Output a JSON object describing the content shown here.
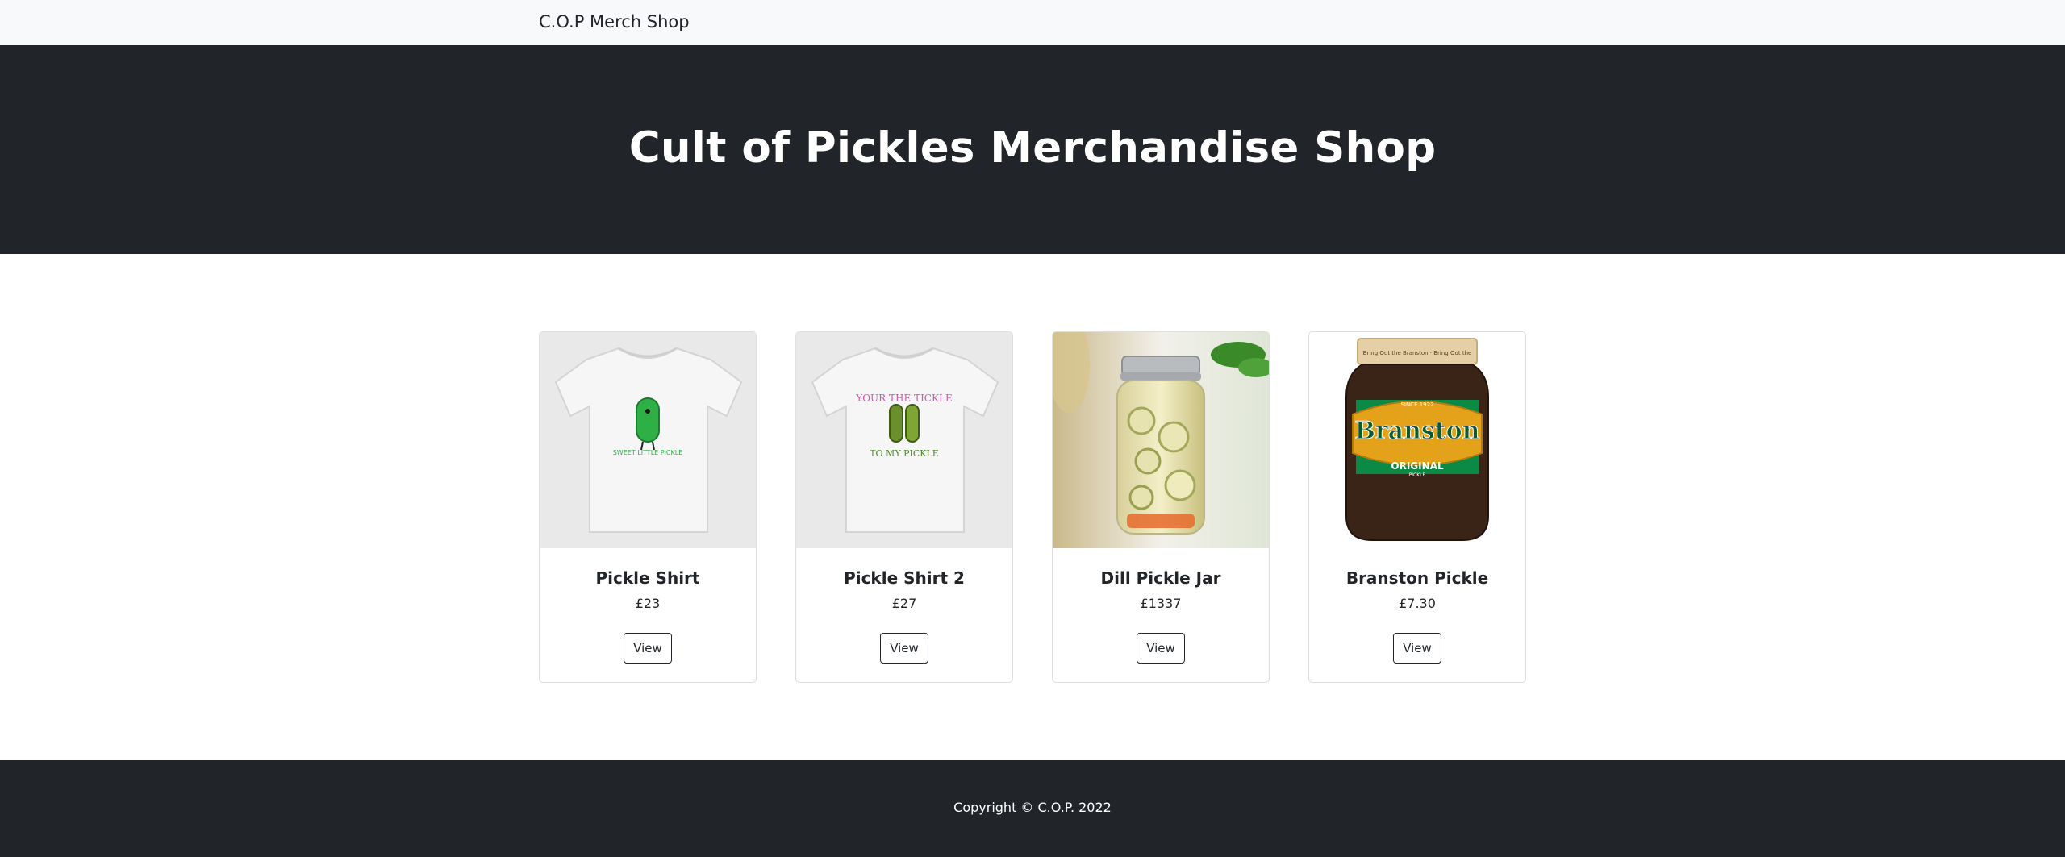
{
  "nav": {
    "brand": "C.O.P Merch Shop"
  },
  "hero": {
    "title": "Cult of Pickles Merchandise Shop"
  },
  "products": [
    {
      "name": "Pickle Shirt",
      "price": "£23",
      "button": "View",
      "image": "pickle-tshirt-image",
      "shirt_text": "SWEET LITTLE PICKLE"
    },
    {
      "name": "Pickle Shirt 2",
      "price": "£27",
      "button": "View",
      "image": "pickle-tshirt-2-image",
      "shirt_text_top": "YOUR THE TICKLE",
      "shirt_text_bottom": "TO MY PICKLE"
    },
    {
      "name": "Dill Pickle Jar",
      "price": "£1337",
      "button": "View",
      "image": "dill-pickle-jar-image"
    },
    {
      "name": "Branston Pickle",
      "price": "£7.30",
      "button": "View",
      "image": "branston-jar-image",
      "jar_brand": "Branston",
      "jar_since": "SINCE 1922",
      "jar_variant": "ORIGINAL",
      "jar_sub": "PICKLE",
      "jar_lid": "Bring Out the Branston · Bring Out the"
    }
  ],
  "footer": {
    "copyright": "Copyright © C.O.P. 2022"
  },
  "colors": {
    "dark": "#212529",
    "nav_bg": "#f8f9fa",
    "pickle_green": "#2eb046",
    "branston_green": "#0b8a46",
    "branston_gold": "#e3a21a"
  }
}
